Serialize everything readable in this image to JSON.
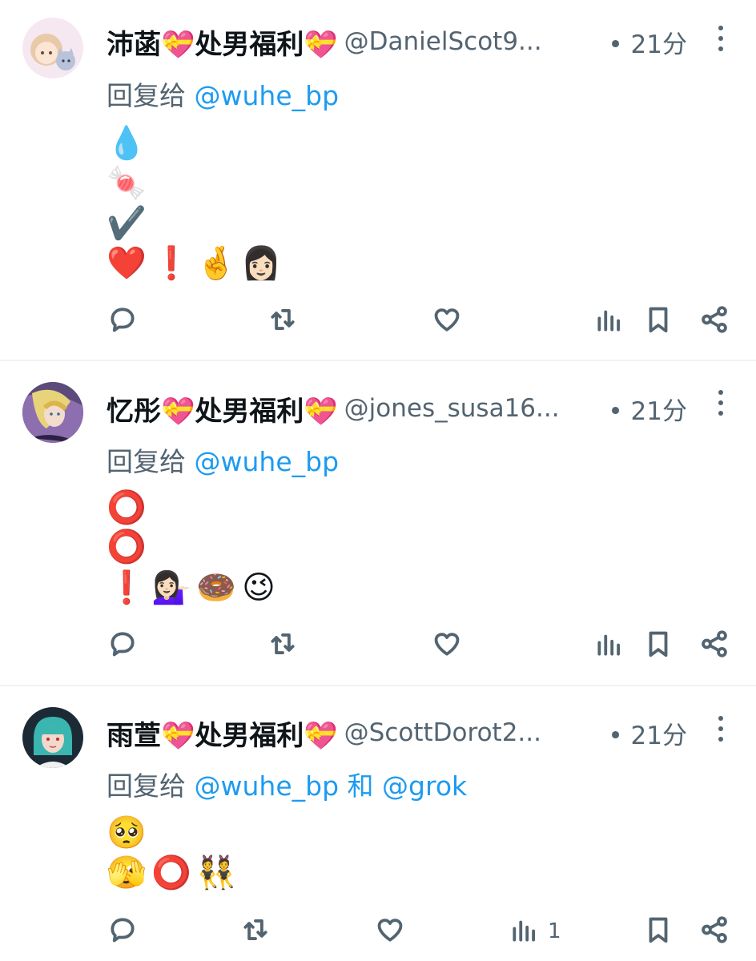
{
  "tweets": [
    {
      "name": "沛菡💝处男福利💝",
      "handle": "@DanielScot9...",
      "time": "• 21分",
      "reply_prefix": "回复给",
      "reply_user1": "@wuhe_bp",
      "reply_and": "",
      "reply_user2": "",
      "lines": [
        [
          "💧"
        ],
        [
          "🍬"
        ],
        [
          "✔️"
        ],
        [
          "❤️",
          "❗",
          "🤞",
          "👩🏻"
        ]
      ],
      "views_count": ""
    },
    {
      "name": "忆彤💝处男福利💝",
      "handle": "@jones_susa16...",
      "time": "• 21分",
      "reply_prefix": "回复给",
      "reply_user1": "@wuhe_bp",
      "reply_and": "",
      "reply_user2": "",
      "lines": [
        [
          "⭕"
        ],
        [
          "⭕"
        ],
        [
          "❗",
          "💁🏻‍♀️",
          "🍩",
          "😉"
        ]
      ],
      "views_count": ""
    },
    {
      "name": "雨萱💝处男福利💝",
      "handle": "@ScottDorot2...",
      "time": "• 21分",
      "reply_prefix": "回复给",
      "reply_user1": "@wuhe_bp",
      "reply_and": "和",
      "reply_user2": "@grok",
      "lines": [
        [
          "🥺"
        ],
        [
          "🫣",
          "⭕",
          "👯"
        ]
      ],
      "views_count": "1"
    }
  ],
  "icons": {
    "reply": "reply-icon",
    "retweet": "retweet-icon",
    "like": "heart-icon",
    "views": "views-icon",
    "bookmark": "bookmark-icon",
    "share": "share-icon",
    "more": "more-vertical-icon"
  },
  "colors": {
    "link": "#1d9bf0",
    "secondary": "#536471",
    "divider": "#eff3f4"
  }
}
